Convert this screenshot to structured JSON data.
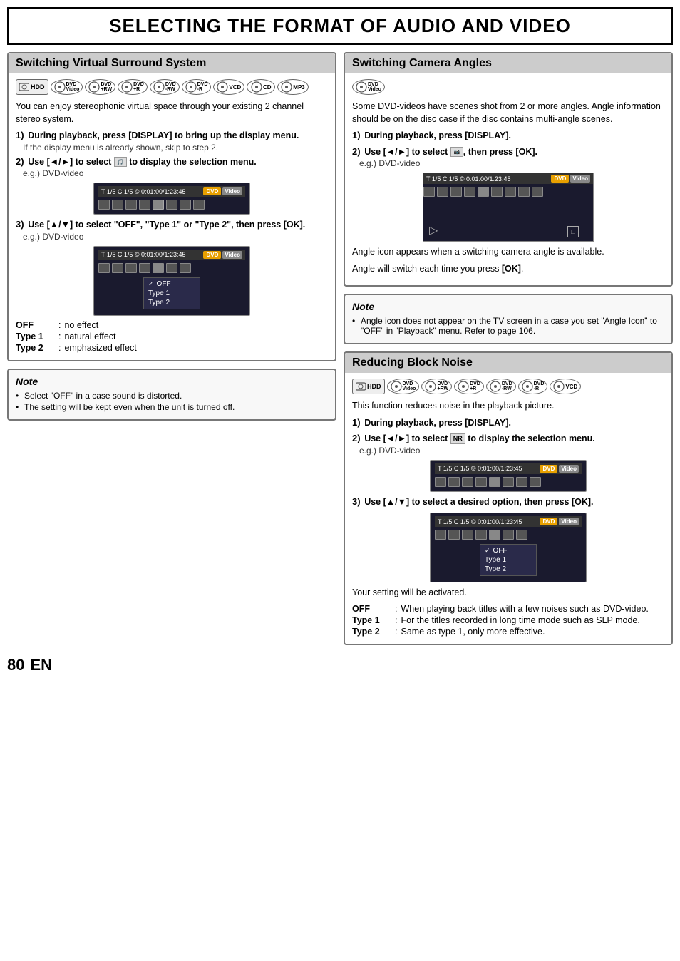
{
  "page": {
    "title": "SELECTING THE FORMAT OF AUDIO AND VIDEO",
    "page_number": "80",
    "page_suffix": "EN"
  },
  "left_section": {
    "title": "Switching Virtual Surround System",
    "media_icons": [
      "HDD",
      "DVD Video",
      "DVD +RW",
      "DVD +R",
      "DVD -RW",
      "DVD -R",
      "VCD",
      "CD",
      "MP3"
    ],
    "intro_text": "You can enjoy stereophonic virtual space through your existing 2 channel stereo system.",
    "steps": [
      {
        "label": "1)",
        "text": "During playback, press [DISPLAY] to bring up the display menu.",
        "sub": "If the display menu is already shown, skip to step 2."
      },
      {
        "label": "2)",
        "text": "Use [◄/►] to select   to display the selection menu.",
        "sub": "e.g.) DVD-video"
      },
      {
        "label": "3)",
        "text": "Use [▲/▼] to select \"OFF\", \"Type 1\" or \"Type 2\", then press [OK].",
        "sub": "e.g.) DVD-video"
      }
    ],
    "screen_top": "T  1/ 5  C  1/ 5  ©    0:01:00 / 1:23:45  +",
    "screen_top2": "T  1/ 5  C  1/ 5  ©    0:01:00 / 1:23:45  +",
    "menu_items": [
      "OFF",
      "Type 1",
      "Type 2"
    ],
    "menu_selected": "OFF",
    "definitions": [
      {
        "term": "OFF",
        "colon": ":",
        "desc": "no effect"
      },
      {
        "term": "Type 1",
        "colon": ":",
        "desc": "natural effect"
      },
      {
        "term": "Type 2",
        "colon": ":",
        "desc": "emphasized effect"
      }
    ],
    "note_title": "Note",
    "note_items": [
      "Select \"OFF\" in a case sound is distorted.",
      "The setting will be kept even when the unit is turned off."
    ]
  },
  "right_top_section": {
    "title": "Switching Camera Angles",
    "media_icons": [
      "DVD Video"
    ],
    "intro_text": "Some DVD-videos have scenes shot from 2 or more angles. Angle information should be on the disc case if the disc contains multi-angle scenes.",
    "steps": [
      {
        "label": "1)",
        "text": "During playback, press [DISPLAY]."
      },
      {
        "label": "2)",
        "text": "Use [◄/►] to select   , then press [OK].",
        "sub": "e.g.) DVD-video"
      }
    ],
    "screen_top": "T  1/ 5  C  1/ 5  ©    0:01:00 / 1:23:45  +",
    "angle_note1": "Angle icon appears when a switching camera angle is available.",
    "angle_note2": "Angle will switch each time you press [OK].",
    "note_title": "Note",
    "note_items": [
      "Angle icon does not appear on the TV screen in a case you set \"Angle Icon\" to \"OFF\" in \"Playback\" menu. Refer to page 106."
    ]
  },
  "right_bottom_section": {
    "title": "Reducing Block Noise",
    "media_icons": [
      "HDD",
      "DVD Video",
      "DVD +RW",
      "DVD +R",
      "DVD -RW",
      "DVD -R",
      "VCD"
    ],
    "intro_text": "This function reduces noise in the playback picture.",
    "steps": [
      {
        "label": "1)",
        "text": "During playback, press [DISPLAY]."
      },
      {
        "label": "2)",
        "text": "Use [◄/►] to select NR to display the selection menu.",
        "sub": "e.g.) DVD-video"
      },
      {
        "label": "3)",
        "text": "Use [▲/▼] to select a desired option, then press [OK]."
      }
    ],
    "screen_top": "T  1/ 5  C  1/ 5  ©    0:01:00 / 1:23:45  +",
    "screen_top2": "T  1/ 5  C  1/ 5  ©    0:01:00 / 1:23:45  +",
    "menu_items": [
      "OFF",
      "Type 1",
      "Type 2"
    ],
    "menu_selected": "OFF",
    "setting_activated": "Your setting will be activated.",
    "definitions": [
      {
        "term": "OFF",
        "colon": ":",
        "desc": "When playing back titles with a few noises such as DVD-video."
      },
      {
        "term": "Type 1",
        "colon": ":",
        "desc": "For the titles recorded in long time mode such as SLP mode."
      },
      {
        "term": "Type 2",
        "colon": ":",
        "desc": "Same as type 1, only more effective."
      }
    ]
  }
}
